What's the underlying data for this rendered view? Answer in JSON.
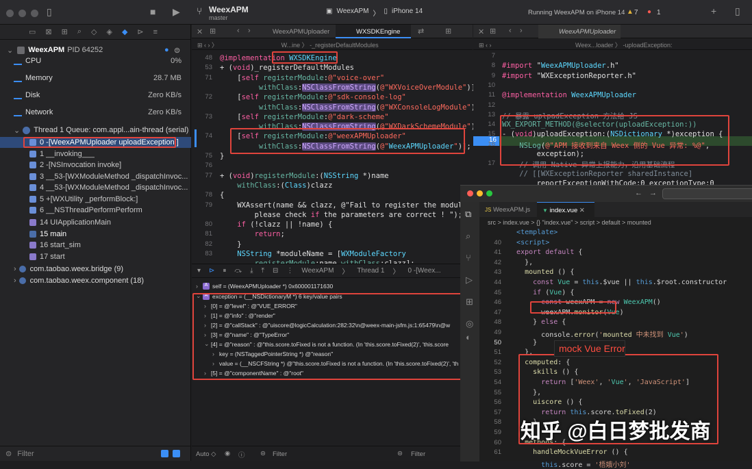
{
  "window": {
    "project": "WeexAPM",
    "branch": "master",
    "scheme": "WeexAPM",
    "device": "iPhone 14",
    "status": "Running WeexAPM on iPhone 14",
    "warnings": "7",
    "errors": "1"
  },
  "tabs": {
    "left_file": "WeexAPMUploader",
    "mid_file": "WXSDKEngine",
    "right_file": "WeexAPMUploader"
  },
  "breadcrumbs": {
    "mid": "W...ine",
    "mid_method": "-_registerDefaultModules",
    "right": "Weex...loader",
    "right_method": "-uploadException:"
  },
  "navigator": {
    "process": "WeexAPM",
    "pid": "PID 64252",
    "gauges": [
      {
        "label": "CPU",
        "value": "0%"
      },
      {
        "label": "Memory",
        "value": "28.7 MB"
      },
      {
        "label": "Disk",
        "value": "Zero KB/s"
      },
      {
        "label": "Network",
        "value": "Zero KB/s"
      }
    ],
    "thread": "Thread 1 Queue: com.appl...ain-thread (serial)",
    "frames": [
      "0 -[WeexAPMUploader uploadException:]",
      "1 __invoking___",
      "2 -[NSInvocation invoke]",
      "3 __53-[WXModuleMethod _dispatchInvoc...",
      "4 __53-[WXModuleMethod _dispatchInvoc...",
      "5 +[WXUtility _performBlock:]",
      "6 __NSThreadPerformPerform",
      "14 UIApplicationMain",
      "15 main",
      "16 start_sim",
      "17 start"
    ],
    "queues": [
      "com.taobao.weex.bridge (9)",
      "com.taobao.weex.component (18)"
    ],
    "filter": "Filter"
  },
  "editor_mid": {
    "lines": [
      "48",
      "53",
      "71",
      "72",
      "73",
      "74",
      "75",
      "76",
      "77",
      "78",
      "79",
      "80",
      "81",
      "82",
      "83"
    ],
    "code": [
      "@implementation WXSDKEngine",
      "+ (void)_registerDefaultModules",
      "    [self registerModule:@\"voice-over\"",
      "         withClass:NSClassFromString(@\"WXVoiceOverModule\")];",
      "    [self registerModule:@\"sdk-console-log\"",
      "         withClass:NSClassFromString(@\"WXConsoleLogModule\")];",
      "    [self registerModule:@\"dark-scheme\"",
      "         withClass:NSClassFromString(@\"WXDarkSchemeModule\")];",
      "    [self registerModule:@\"weexAPMUploader\"",
      "         withClass:NSClassFromString(@\"WeexAPMUploader\")];",
      "}",
      "",
      "+ (void)registerModule:(NSString *)name",
      "    withClass:(Class)clazz",
      "{",
      "    WXAssert(name && clazz, @\"Fail to register the module,",
      "        please check if the parameters are correct ! \");",
      "    if (!clazz || !name) {",
      "        return;",
      "    }",
      "    NSString *moduleName = [WXModuleFactory",
      "        registerModule:name withClass:clazz];"
    ]
  },
  "editor_right": {
    "lines": [
      "7",
      "8",
      "9",
      "10",
      "11",
      "12",
      "13",
      "14",
      "15",
      "16",
      "",
      "17"
    ],
    "code": [
      "",
      "#import \"WeexAPMUploader.h\"",
      "#import \"WXExceptionReporter.h\"",
      "",
      "@implementation WeexAPMUploader",
      "",
      "// 暴露 uplpadException 方法给 JS",
      "WX_EXPORT_METHOD(@selector(uploadException:))",
      "- (void)uploadException:(NSDictionary *)exception {",
      "    NSLog(@\"APM 接收到来自 Weex 侧的 Vue 异常: %@\",",
      "        exception);",
      "    // 调用 Native 异常上报能力，沿用基础流程",
      "    // [[WXExceptionReporter sharedInstance]",
      "        reportExceptionWithCode:0 exceptionType:0"
    ]
  },
  "debug": {
    "thread": "Thread 1",
    "frame": "0 -[Weex...",
    "vars": [
      "self = (WeexAPMUploader *) 0x600001171630",
      "exception = (__NSDictionaryM *) 6 key/value pairs",
      "[0] = @\"level\" : @\"VUE_ERROR\"",
      "[1] = @\"info\" : @\"render\"",
      "[2] = @\"callStack\" : @\"uiscore@logicCalculation:282:32\\n@weex-main-jsfm.js:1:65479\\n@w",
      "[3] = @\"name\" : @\"TypeError\"",
      "[4] = @\"reason\" : @\"this.score.toFixed is not a function. (In 'this.score.toFixed(2)', 'this.score",
      "key = (NSTaggedPointerString *) @\"reason\"",
      "value = (__NSCFString *) @\"this.score.toFixed is not a function. (In 'this.score.toFixed(2)', 'th",
      "[5] = @\"componentName\" : @\"root\""
    ],
    "auto": "Auto ◇",
    "filter": "Filter"
  },
  "vscode": {
    "tabs": [
      "WeexAPM.js",
      "index.vue"
    ],
    "breadcrumb": "src > index.vue > {} \"index.vue\" > script > default > mounted",
    "lines": [
      "40",
      "41",
      "42",
      "43",
      "44",
      "45",
      "46",
      "47",
      "48",
      "49",
      "50",
      "51",
      "52",
      "53",
      "54",
      "55",
      "56",
      "57",
      "58",
      "59",
      "60",
      "61"
    ],
    "code": [
      "  <template>",
      "  <script>",
      "  export default {",
      "    },",
      "    mounted () {",
      "      const Vue = this.$vue || this.$root.constructor",
      "      if (Vue) {",
      "        const weexAPM = new WeexAPM()",
      "        weexAPM.monitor(Vue)",
      "      } else {",
      "        console.error('mounted 中未找到 Vue')",
      "      }",
      "    },",
      "    computed: {",
      "      skills () {",
      "        return ['Weex', 'Vue', 'JavaScript']",
      "      },",
      "      uiscore () {",
      "        return this.score.toFixed(2)",
      "      }",
      "    },",
      "    methods: {",
      "      handleMockVueError () {",
      "        this.score = '梧娥小刘'"
    ],
    "annotation": "mock Vue Error",
    "watermark": "知乎 @白日梦批发商"
  }
}
